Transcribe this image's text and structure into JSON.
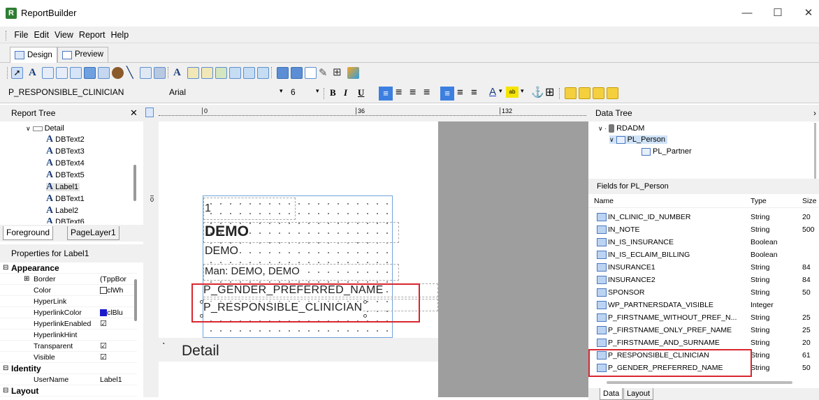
{
  "window": {
    "title": "ReportBuilder",
    "app_icon_letter": "R"
  },
  "menu": [
    "File",
    "Edit",
    "View",
    "Report",
    "Help"
  ],
  "tabs": [
    {
      "label": "Design"
    },
    {
      "label": "Preview"
    }
  ],
  "format_bar": {
    "component_name": "P_RESPONSIBLE_CLINICIAN",
    "font": "Arial",
    "font_size": "6",
    "bold": "B",
    "italic": "I",
    "underline": "U"
  },
  "report_tree": {
    "title": "Report Tree",
    "items": [
      {
        "label": "Detail",
        "type": "band"
      },
      {
        "label": "DBText2",
        "type": "dbtext"
      },
      {
        "label": "DBText3",
        "type": "dbtext"
      },
      {
        "label": "DBText4",
        "type": "dbtext"
      },
      {
        "label": "DBText5",
        "type": "dbtext"
      },
      {
        "label": "Label1",
        "type": "label",
        "selected": true
      },
      {
        "label": "DBText1",
        "type": "dbtext"
      },
      {
        "label": "Label2",
        "type": "label"
      },
      {
        "label": "DBText6",
        "type": "dbtext"
      }
    ],
    "layer_tabs": [
      "Foreground",
      "PageLayer1"
    ]
  },
  "properties": {
    "title": "Properties for Label1",
    "rows": [
      {
        "category": true,
        "name": "Appearance"
      },
      {
        "name": "Border",
        "value": "(TppBor",
        "expand": true
      },
      {
        "name": "Color",
        "value": "clWh",
        "swatch": "#ffffff"
      },
      {
        "name": "HyperLink",
        "value": ""
      },
      {
        "name": "HyperlinkColor",
        "value": "clBlu",
        "swatch": "#1a1acc"
      },
      {
        "name": "HyperlinkEnabled",
        "value": "",
        "check": "☑"
      },
      {
        "name": "HyperlinkHint",
        "value": ""
      },
      {
        "name": "Transparent",
        "value": "",
        "check": "☑"
      },
      {
        "name": "Visible",
        "value": "",
        "check": "☑"
      },
      {
        "category": true,
        "name": "Identity"
      },
      {
        "name": "UserName",
        "value": "Label1"
      },
      {
        "category": true,
        "name": "Layout"
      }
    ]
  },
  "ruler": {
    "marks": [
      "0",
      "36",
      "132"
    ],
    "left_mark": "0"
  },
  "design": {
    "fields": [
      {
        "text": "1"
      },
      {
        "text": "DEMO"
      },
      {
        "text": "DEMO"
      },
      {
        "text": "Man: DEMO, DEMO"
      },
      {
        "text": "P_GENDER_PREFERRED_NAME"
      },
      {
        "text": "P_RESPONSIBLE_CLINICIAN"
      }
    ],
    "band_label": "Detail"
  },
  "data_tree": {
    "title": "Data Tree",
    "root": "RDADM",
    "children": [
      "PL_Person",
      "PL_Partner"
    ],
    "fields_title": "Fields for PL_Person",
    "columns": [
      "Name",
      "Type",
      "Size"
    ],
    "fields": [
      {
        "name": "IN_CLINIC_ID_NUMBER",
        "type": "String",
        "size": "20"
      },
      {
        "name": "IN_NOTE",
        "type": "String",
        "size": "500"
      },
      {
        "name": "IN_IS_INSURANCE",
        "type": "Boolean",
        "size": ""
      },
      {
        "name": "IN_IS_ECLAIM_BILLING",
        "type": "Boolean",
        "size": ""
      },
      {
        "name": "INSURANCE1",
        "type": "String",
        "size": "84"
      },
      {
        "name": "INSURANCE2",
        "type": "String",
        "size": "84"
      },
      {
        "name": "SPONSOR",
        "type": "String",
        "size": "50"
      },
      {
        "name": "WP_PARTNERSDATA_VISIBLE",
        "type": "Integer",
        "size": ""
      },
      {
        "name": "P_FIRSTNAME_WITHOUT_PREF_N...",
        "type": "String",
        "size": "25"
      },
      {
        "name": "P_FIRSTNAME_ONLY_PREF_NAME",
        "type": "String",
        "size": "25"
      },
      {
        "name": "P_FIRSTNAME_AND_SURNAME",
        "type": "String",
        "size": "20"
      },
      {
        "name": "P_RESPONSIBLE_CLINICIAN",
        "type": "String",
        "size": "61"
      },
      {
        "name": "P_GENDER_PREFERRED_NAME",
        "type": "String",
        "size": "50"
      }
    ],
    "bottom_tabs": [
      "Data",
      "Layout"
    ]
  }
}
